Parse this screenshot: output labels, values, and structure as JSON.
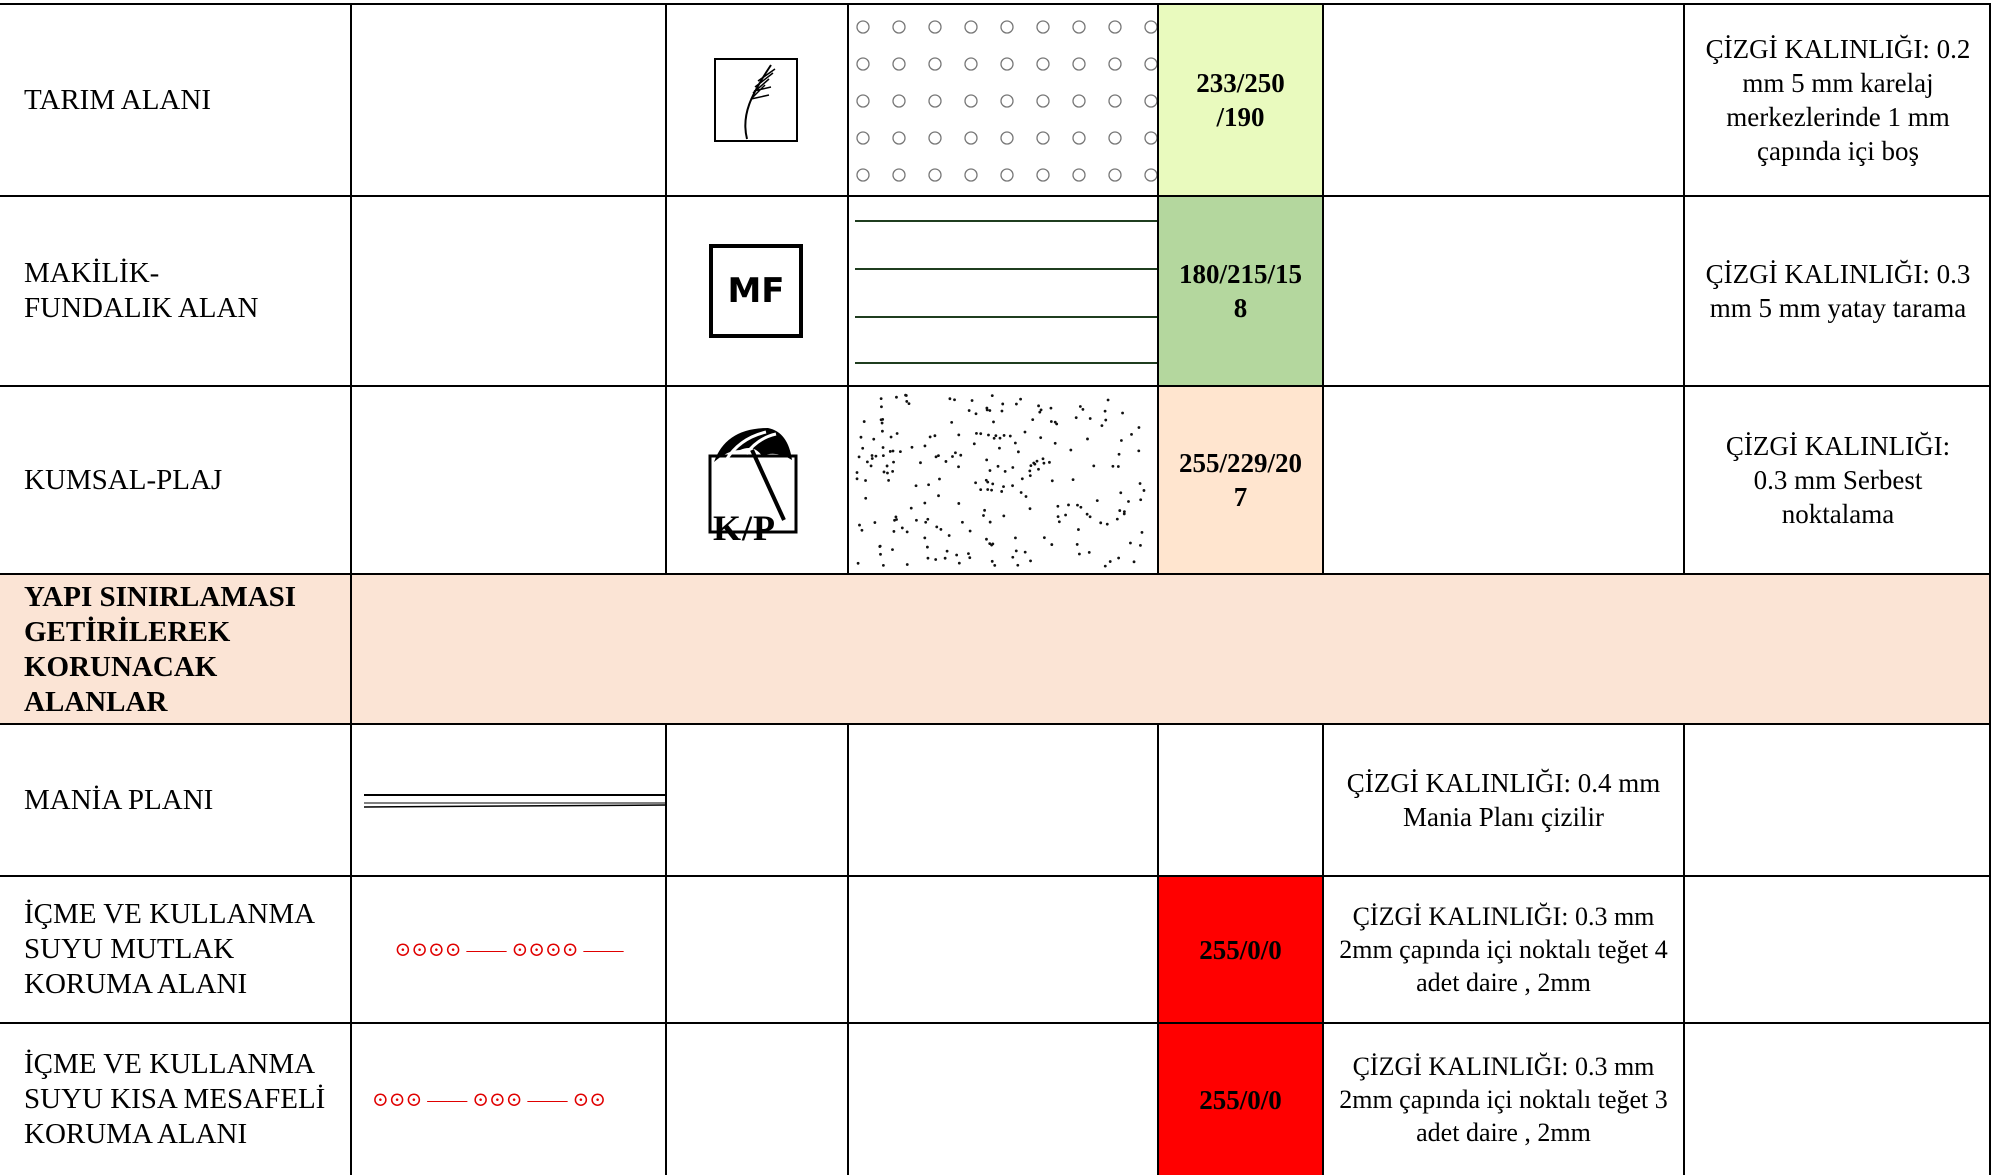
{
  "rows": [
    {
      "name": "TARIM ALANI",
      "rgb": "233/250\n/190",
      "rgb_color": "#e9fabe",
      "note_right": "ÇİZGİ KALINLIĞI: 0.2 mm 5 mm karelaj merkezlerinde 1 mm çapında içi boş"
    },
    {
      "name": "MAKİLİK-\nFUNDALIK ALAN",
      "symbol_text": "MF",
      "rgb": "180/215/15\n8",
      "rgb_color": "#b4d79e",
      "note_right": "ÇİZGİ KALINLIĞI: 0.3 mm 5 mm yatay tarama"
    },
    {
      "name": "KUMSAL-PLAJ",
      "symbol_text": "K/P",
      "rgb": "255/229/20\n7",
      "rgb_color": "#ffe5cf",
      "note_right": "ÇİZGİ KALINLIĞI: 0.3 mm Serbest noktalama"
    }
  ],
  "section": {
    "heading": "YAPI SINIRLAMASI GETİRİLEREK KORUNACAK ALANLAR",
    "bg_color": "#fbe4d5"
  },
  "rows2": [
    {
      "name": "MANİA PLANI",
      "note_mid": "ÇİZGİ KALINLIĞI: 0.4 mm Mania Planı çizilir"
    },
    {
      "name": "İÇME VE KULLANMA SUYU MUTLAK KORUMA ALANI",
      "line_symbol": "⊙⊙⊙⊙ —— ⊙⊙⊙⊙ ——",
      "rgb": "255/0/0",
      "rgb_color": "#ff0000",
      "note_mid": "ÇİZGİ KALINLIĞI: 0.3 mm\n2mm çapında içi noktalı teğet 4 adet daire , 2mm"
    },
    {
      "name": "İÇME VE KULLANMA SUYU KISA MESAFELİ KORUMA ALANI",
      "line_symbol": "⊙⊙⊙ —— ⊙⊙⊙ —— ⊙⊙",
      "rgb": "255/0/0",
      "rgb_color": "#ff0000",
      "note_mid": "ÇİZGİ KALINLIĞI: 0.3 mm\n2mm çapında içi noktalı teğet 3 adet daire , 2mm"
    }
  ]
}
